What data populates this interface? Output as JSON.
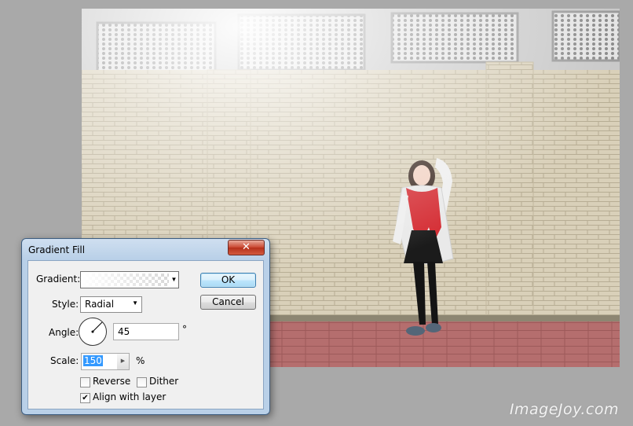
{
  "dialog": {
    "title": "Gradient Fill",
    "close_label": "✕",
    "gradient_label": "Gradient:",
    "style_label": "Style:",
    "style_value": "Radial",
    "angle_label": "Angle:",
    "angle_value": "45",
    "angle_unit": "°",
    "scale_label": "Scale:",
    "scale_value": "150",
    "scale_unit": "%",
    "reverse_label": "Reverse",
    "reverse_checked": false,
    "dither_label": "Dither",
    "dither_checked": false,
    "align_label": "Align with layer",
    "align_checked": true,
    "ok_label": "OK",
    "cancel_label": "Cancel"
  },
  "watermark": "ImageJoy.com",
  "icons": {
    "dropdown": "chevron-down-icon",
    "spin": "chevron-right-icon",
    "check": "checkmark-icon"
  },
  "colors": {
    "dialog_frame": "#b9d0e8",
    "close_button": "#c9452f",
    "default_button": "#a7d9f5",
    "scarf": "#d42b32",
    "brick_floor": "#b36a6a",
    "wall": "#d6cdb6"
  }
}
